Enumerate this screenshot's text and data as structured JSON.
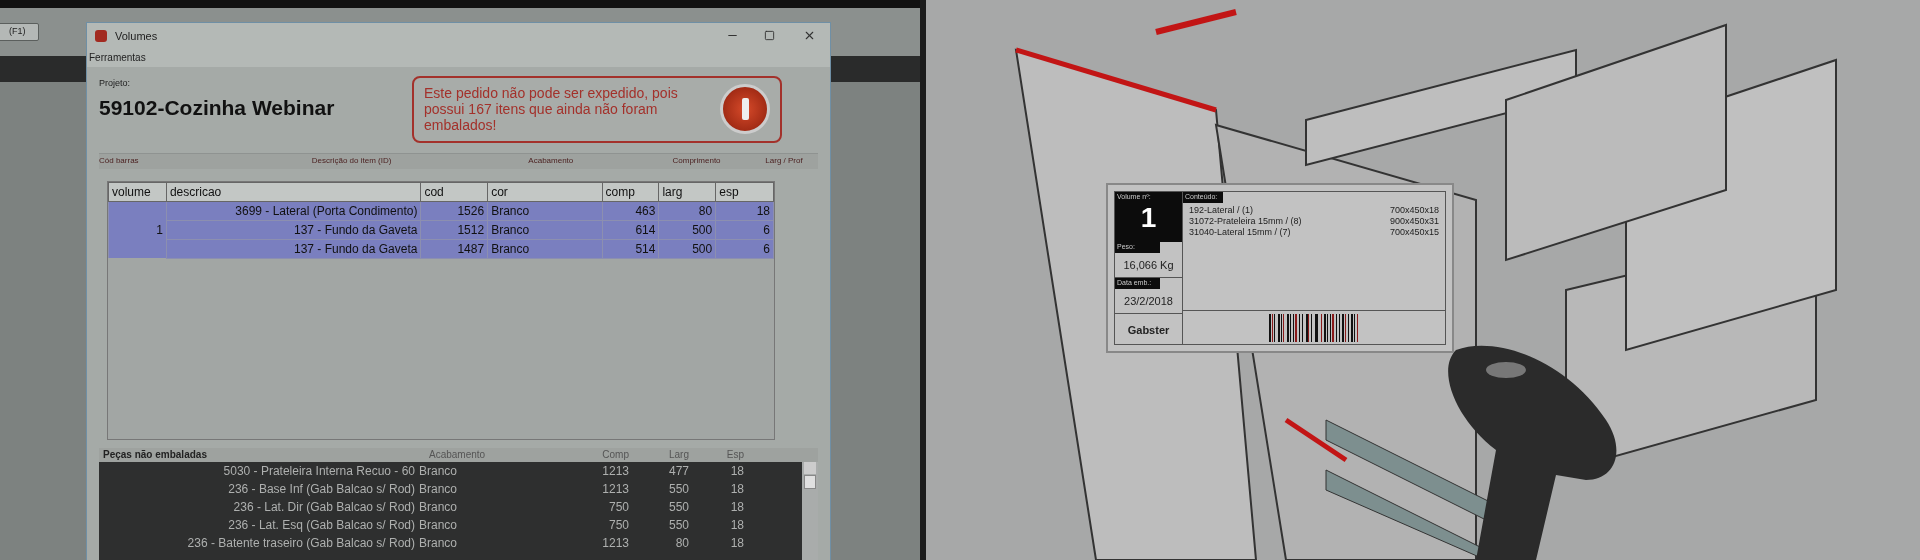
{
  "background_app": {
    "button": "(F1)"
  },
  "window": {
    "title": "Volumes",
    "menu": [
      "Ferramentas"
    ],
    "project_label": "Projeto:",
    "project_name": "59102-Cozinha Webinar",
    "alert": "Este pedido não pode ser expedido, pois possui 167 itens que ainda não foram embalados!",
    "header_labels": [
      "Cód barras",
      "Descrição do item (ID)",
      "Acabamento",
      "Comprimento",
      "Larg / Prof"
    ]
  },
  "volumes_table": {
    "columns": [
      "volume",
      "descricao",
      "cod",
      "cor",
      "comp",
      "larg",
      "esp"
    ],
    "groups": [
      {
        "volume": "1",
        "selected": true,
        "rows": [
          {
            "descricao": "3699 - Lateral (Porta Condimento)",
            "cod": "1526",
            "cor": "Branco",
            "comp": "463",
            "larg": "80",
            "esp": "18"
          },
          {
            "descricao": "137 - Fundo da Gaveta",
            "cod": "1512",
            "cor": "Branco",
            "comp": "614",
            "larg": "500",
            "esp": "6"
          },
          {
            "descricao": "137 - Fundo da Gaveta",
            "cod": "1487",
            "cor": "Branco",
            "comp": "514",
            "larg": "500",
            "esp": "6"
          }
        ]
      }
    ]
  },
  "unpacked": {
    "title": "Peças não embaladas",
    "columns": [
      "Acabamento",
      "Comp",
      "Larg",
      "Esp"
    ],
    "rows": [
      {
        "description": "5030 - Prateleira Interna Recuo - 60",
        "finish": "Branco",
        "comp": "1213",
        "larg": "477",
        "esp": "18"
      },
      {
        "description": "236 - Base Inf (Gab Balcao s/ Rod)",
        "finish": "Branco",
        "comp": "1213",
        "larg": "550",
        "esp": "18"
      },
      {
        "description": "236 - Lat. Dir (Gab Balcao s/ Rod)",
        "finish": "Branco",
        "comp": "750",
        "larg": "550",
        "esp": "18"
      },
      {
        "description": "236 - Lat. Esq (Gab Balcao s/ Rod)",
        "finish": "Branco",
        "comp": "750",
        "larg": "550",
        "esp": "18"
      },
      {
        "description": "236 - Batente traseiro (Gab Balcao s/ Rod)",
        "finish": "Branco",
        "comp": "1213",
        "larg": "80",
        "esp": "18"
      }
    ]
  },
  "label": {
    "volume_label": "Volume nº:",
    "volume": "1",
    "weight_label": "Peso:",
    "weight": "16,066 Kg",
    "date_label": "Data emb.:",
    "date": "23/2/2018",
    "brand": "Gabster",
    "contents_label": "Conteúdo:",
    "contents": [
      {
        "name": "192-Lateral / (1)",
        "size": "700x450x18"
      },
      {
        "name": "31072-Prateleira 15mm / (8)",
        "size": "900x450x31"
      },
      {
        "name": "31040-Lateral 15mm / (7)",
        "size": "700x450x15"
      }
    ]
  }
}
